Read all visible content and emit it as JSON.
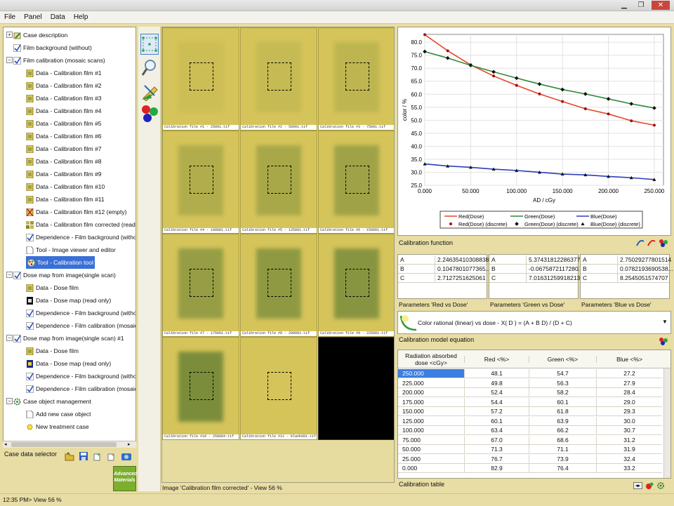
{
  "menu": [
    "File",
    "Panel",
    "Data",
    "Help"
  ],
  "tree": {
    "items": [
      {
        "label": "Case description",
        "depth": 0,
        "toggle": "+",
        "icon": "case-icon"
      },
      {
        "label": "Film background (without)",
        "depth": 0,
        "toggle": "",
        "icon": "check-icon"
      },
      {
        "label": "Film calibration (mosaic scans)",
        "depth": 0,
        "toggle": "-",
        "icon": "check-icon"
      },
      {
        "label": "Data - Calibration film #1",
        "depth": 1,
        "icon": "film-icon"
      },
      {
        "label": "Data - Calibration film #2",
        "depth": 1,
        "icon": "film-icon"
      },
      {
        "label": "Data - Calibration film #3",
        "depth": 1,
        "icon": "film-icon"
      },
      {
        "label": "Data - Calibration film #4",
        "depth": 1,
        "icon": "film-icon"
      },
      {
        "label": "Data - Calibration film #5",
        "depth": 1,
        "icon": "film-icon"
      },
      {
        "label": "Data - Calibration film #6",
        "depth": 1,
        "icon": "film-icon"
      },
      {
        "label": "Data - Calibration film #7",
        "depth": 1,
        "icon": "film-icon"
      },
      {
        "label": "Data - Calibration film #8",
        "depth": 1,
        "icon": "film-icon"
      },
      {
        "label": "Data - Calibration film #9",
        "depth": 1,
        "icon": "film-icon"
      },
      {
        "label": "Data - Calibration film #10",
        "depth": 1,
        "icon": "film-icon"
      },
      {
        "label": "Data - Calibration film #11",
        "depth": 1,
        "icon": "film-icon"
      },
      {
        "label": "Data - Calibration film #12 (empty)",
        "depth": 1,
        "icon": "film-empty-icon"
      },
      {
        "label": "Data - Calibration film corrected (read only)",
        "depth": 1,
        "icon": "film-mosaic-icon"
      },
      {
        "label": "Dependence - Film background (without)",
        "depth": 1,
        "icon": "check-icon"
      },
      {
        "label": "Tool - Image viewer and editor",
        "depth": 1,
        "icon": "doc-icon"
      },
      {
        "label": "Tool - Calibration tool",
        "depth": 1,
        "icon": "palette-icon",
        "selected": true
      },
      {
        "label": "Dose map from image(single scan)",
        "depth": 0,
        "toggle": "-",
        "icon": "check-icon"
      },
      {
        "label": "Data - Dose film",
        "depth": 1,
        "icon": "film-icon"
      },
      {
        "label": "Data - Dose map (read only)",
        "depth": 1,
        "icon": "dosemap-icon"
      },
      {
        "label": "Dependence - Film background (without)",
        "depth": 1,
        "icon": "check-icon"
      },
      {
        "label": "Dependence - Film calibration (mosaic scan",
        "depth": 1,
        "icon": "check-icon"
      },
      {
        "label": "Dose map from image(single scan) #1",
        "depth": 0,
        "toggle": "-",
        "icon": "check-icon"
      },
      {
        "label": "Data - Dose film",
        "depth": 1,
        "icon": "film-icon"
      },
      {
        "label": "Data - Dose map (read only)",
        "depth": 1,
        "icon": "dosemap-blue-icon"
      },
      {
        "label": "Dependence - Film background (without)",
        "depth": 1,
        "icon": "check-icon"
      },
      {
        "label": "Dependence - Film calibration (mosaic scan",
        "depth": 1,
        "icon": "check-icon"
      },
      {
        "label": "Case object management",
        "depth": 0,
        "toggle": "-",
        "icon": "gear-icon"
      },
      {
        "label": "Add new case object",
        "depth": 1,
        "icon": "doc-icon"
      },
      {
        "label": "New treatment case",
        "depth": 1,
        "icon": "sun-icon"
      }
    ]
  },
  "selector": {
    "label": "Case data selector"
  },
  "logo": {
    "line1": "Advanced",
    "line2": "Materials"
  },
  "viewer": {
    "tiles": [
      {
        "caption": "Calibration file #1 - 25001.tif",
        "shade": 0.05
      },
      {
        "caption": "Calibration file #2 - 50001.tif",
        "shade": 0.12
      },
      {
        "caption": "Calibration file #3 - 75001.tif",
        "shade": 0.2
      },
      {
        "caption": "Calibration file #4 - 100001.tif",
        "shade": 0.35
      },
      {
        "caption": "Calibration file #5 - 125001.tif",
        "shade": 0.45
      },
      {
        "caption": "Calibration file #6 - 150001.tif",
        "shade": 0.55
      },
      {
        "caption": "Calibration file #7 - 175001.tif",
        "shade": 0.65
      },
      {
        "caption": "Calibration file #8 - 200001.tif",
        "shade": 0.72
      },
      {
        "caption": "Calibration file #9 - 225001.tif",
        "shade": 0.8
      },
      {
        "caption": "Calibration file #10 - 250004.tif",
        "shade": 0.95
      },
      {
        "caption": "Calibration file #11 - blank001.tif",
        "shade": 0.0
      },
      {
        "caption": "",
        "shade": -1
      }
    ],
    "caption": "Image 'Calibration film corrected' - View   56 %"
  },
  "chart_data": {
    "type": "line",
    "xlabel": "AD / cGy",
    "ylabel": "color / %",
    "xlim": [
      0,
      260
    ],
    "ylim": [
      25,
      83
    ],
    "xticks": [
      "0.000",
      "50.000",
      "100.000",
      "150.000",
      "200.000",
      "250.000"
    ],
    "xtick_values": [
      0,
      50,
      100,
      150,
      200,
      250
    ],
    "yticks": [
      "25.0",
      "30.0",
      "35.0",
      "40.0",
      "45.0",
      "50.0",
      "55.0",
      "60.0",
      "65.0",
      "70.0",
      "75.0",
      "80.0"
    ],
    "ytick_values": [
      25,
      30,
      35,
      40,
      45,
      50,
      55,
      60,
      65,
      70,
      75,
      80
    ],
    "x": [
      0,
      25,
      50,
      75,
      100,
      125,
      150,
      175,
      200,
      225,
      250
    ],
    "series": [
      {
        "name": "Red(Dose)",
        "discrete_name": "Red(Dose) (discrete)",
        "color": "#e8452a",
        "values": [
          82.9,
          76.7,
          71.3,
          67.0,
          63.4,
          60.1,
          57.2,
          54.4,
          52.4,
          49.8,
          48.1
        ]
      },
      {
        "name": "Green(Dose)",
        "discrete_name": "Green(Dose) (discrete)",
        "color": "#2f8a3a",
        "values": [
          76.4,
          73.9,
          71.1,
          68.6,
          66.2,
          63.9,
          61.8,
          60.1,
          58.2,
          56.3,
          54.7
        ]
      },
      {
        "name": "Blue(Dose)",
        "discrete_name": "Blue(Dose) (discrete)",
        "color": "#2b3fb8",
        "values": [
          33.2,
          32.4,
          31.9,
          31.2,
          30.7,
          30.0,
          29.3,
          29.0,
          28.4,
          27.9,
          27.2
        ]
      }
    ]
  },
  "calib": {
    "title": "Calibration function",
    "groups": [
      {
        "rows": [
          [
            "A",
            "2.24635410308838"
          ],
          [
            "B",
            "0.1047801077365..."
          ],
          [
            "C",
            "2.7127251625061"
          ]
        ],
        "label": "Parameters 'Red vs Dose'"
      },
      {
        "rows": [
          [
            "A",
            "5.37431812286377"
          ],
          [
            "B",
            "-0.0675872117280..."
          ],
          [
            "C",
            "7.01631259918213"
          ]
        ],
        "label": "Parameters 'Green vs Dose'"
      },
      {
        "rows": [
          [
            "A",
            "2.75029277801514"
          ],
          [
            "B",
            "0.0782193690538..."
          ],
          [
            "C",
            "8.2545051574707"
          ]
        ],
        "label": "Parameters 'Blue vs Dose'"
      }
    ],
    "model": "Color rational (linear) vs dose - X( D ) = (A + B D) / (D + C)",
    "model_label": "Calibration model equation"
  },
  "table": {
    "headers": [
      "Radiation absorbed dose  <cGy>",
      "Red <%>",
      "Green <%>",
      "Blue <%>"
    ],
    "rows": [
      [
        "250.000",
        "48.1",
        "54.7",
        "27.2"
      ],
      [
        "225.000",
        "49.8",
        "56.3",
        "27.9"
      ],
      [
        "200.000",
        "52.4",
        "58.2",
        "28.4"
      ],
      [
        "175.000",
        "54.4",
        "60.1",
        "29.0"
      ],
      [
        "150.000",
        "57.2",
        "61.8",
        "29.3"
      ],
      [
        "125.000",
        "60.1",
        "63.9",
        "30.0"
      ],
      [
        "100.000",
        "63.4",
        "66.2",
        "30.7"
      ],
      [
        "75.000",
        "67.0",
        "68.6",
        "31.2"
      ],
      [
        "50.000",
        "71.3",
        "71.1",
        "31.9"
      ],
      [
        "25.000",
        "76.7",
        "73.9",
        "32.4"
      ],
      [
        "0.000",
        "82.9",
        "76.4",
        "33.2"
      ]
    ],
    "label": "Calibration table"
  },
  "status": "12:35 PM> View   56 %"
}
